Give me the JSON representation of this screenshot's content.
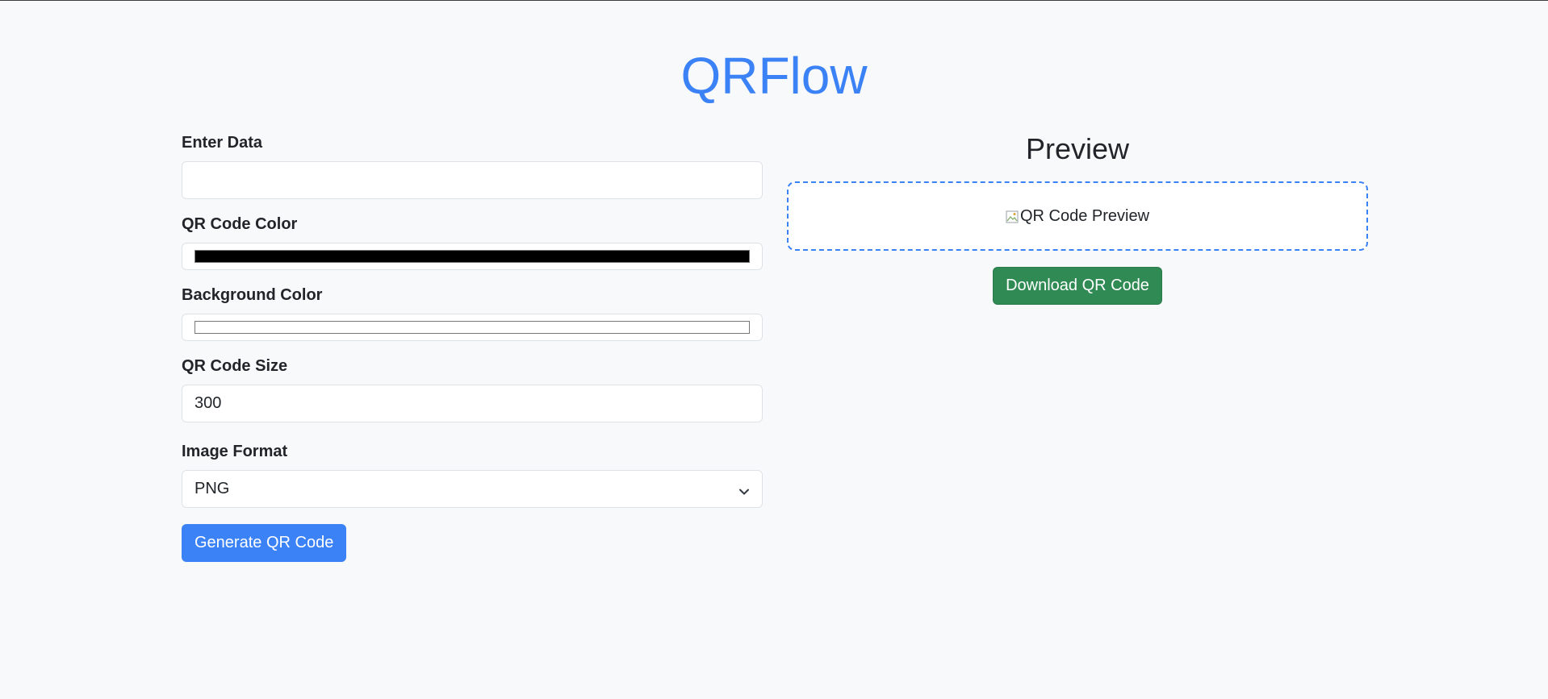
{
  "app": {
    "title": "QRFlow"
  },
  "form": {
    "data_label": "Enter Data",
    "data_value": "",
    "qr_color_label": "QR Code Color",
    "qr_color_value": "#000000",
    "bg_color_label": "Background Color",
    "bg_color_value": "#ffffff",
    "size_label": "QR Code Size",
    "size_value": "300",
    "format_label": "Image Format",
    "format_value": "PNG",
    "generate_label": "Generate QR Code"
  },
  "preview": {
    "title": "Preview",
    "image_alt": "QR Code Preview",
    "download_label": "Download QR Code"
  },
  "icons": {
    "select": "chevron-down-icon",
    "image": "broken-image-icon"
  },
  "colors": {
    "brand": "#3b82f6",
    "primary_button": "#3b82f6",
    "success_button": "#2f8a54",
    "background": "#f8f9fa"
  }
}
